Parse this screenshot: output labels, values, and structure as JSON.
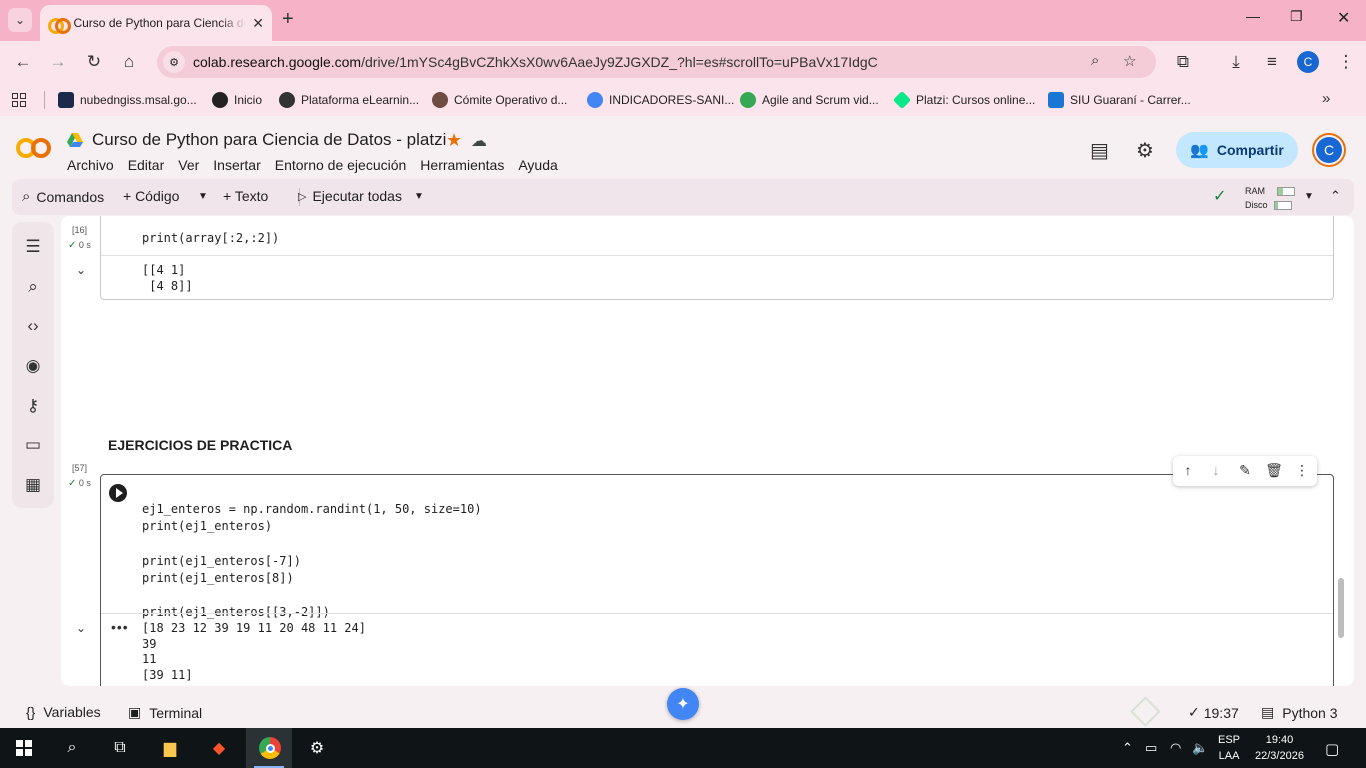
{
  "browser": {
    "tab_title": "Curso de Python para Ciencia de Datos - platzi",
    "url_host": "colab.research.google.com",
    "url_path": "/drive/1mYSc4gBvCZhkXsX0wv6AaeJy9ZJGXDZ_?hl=es#scrollTo=uPBaVx17IdgC",
    "profile_initial": "C",
    "bookmarks": [
      {
        "label": "nubedngiss.msal.go...",
        "color": "#1b2a4a"
      },
      {
        "label": "Inicio",
        "color": "#222222"
      },
      {
        "label": "Plataforma eLearnin...",
        "color": "#333333"
      },
      {
        "label": "Cómite Operativo d...",
        "color": "#6d4c41"
      },
      {
        "label": "INDICADORES-SANI...",
        "color": "#4285f4"
      },
      {
        "label": "Agile and Scrum vid...",
        "color": "#34a853"
      },
      {
        "label": "Platzi: Cursos online...",
        "color": "#0ae98a"
      },
      {
        "label": "SIU Guaraní - Carrer...",
        "color": "#1976d2"
      }
    ]
  },
  "colab": {
    "notebook_title": "Curso de Python para Ciencia de Datos - platzi",
    "menu": [
      "Archivo",
      "Editar",
      "Ver",
      "Insertar",
      "Entorno de ejecución",
      "Herramientas",
      "Ayuda"
    ],
    "share_label": "Compartir",
    "avatar_initial": "C",
    "toolbar": {
      "commands": "Comandos",
      "code": "+ Código",
      "text": "+ Texto",
      "run_all": "Ejecutar todas"
    },
    "resources": {
      "ram_label": "RAM",
      "disk_label": "Disco",
      "ram_usage": 0.3,
      "disk_usage": 0.2
    },
    "cells": {
      "cell1": {
        "exec_count": "[16]",
        "time": "0 s",
        "code": "print(array[:2,:2])",
        "output": "[[4 1]\n [4 8]]"
      },
      "section_title": "EJERCICIOS DE PRACTICA",
      "cell2": {
        "exec_count": "[57]",
        "time": "0 s",
        "code_lines": [
          "ej1_enteros = np.random.randint(1, 50, size=10)",
          "print(ej1_enteros)",
          "",
          "print(ej1_enteros[-7])",
          "print(ej1_enteros[8])",
          "",
          "print(ej1_enteros[[3,-2]])"
        ],
        "output": "[18 23 12 39 19 11 20 48 11 24]\n39\n11\n[39 11]"
      }
    },
    "statusbar": {
      "variables": "Variables",
      "terminal": "Terminal",
      "last_run": "19:37",
      "runtime": "Python 3"
    }
  },
  "taskbar": {
    "lang_top": "ESP",
    "lang_bottom": "LAA",
    "time": "19:40",
    "date": "22/3/2026"
  }
}
